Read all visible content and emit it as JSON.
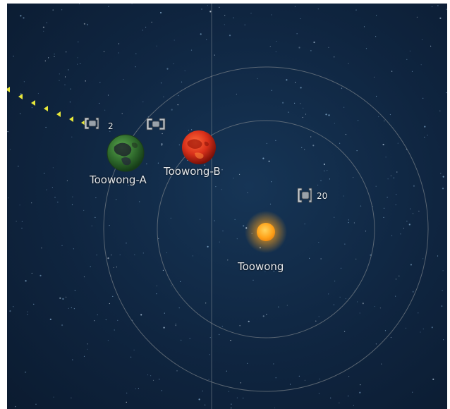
{
  "map": {
    "system_name": "Toowong",
    "planets": [
      {
        "name": "Toowong-A"
      },
      {
        "name": "Toowong-B"
      }
    ],
    "fleets": [
      {
        "id": "fleet-1",
        "count": "2"
      },
      {
        "id": "fleet-2",
        "count": ""
      },
      {
        "id": "fleet-3",
        "count": "20"
      }
    ],
    "colors": {
      "star": "#ffa31a",
      "planet_a": "#3f7f3a",
      "planet_b": "#d8301a",
      "route": "#e8e83a",
      "orbit": "#8a8f93"
    }
  }
}
